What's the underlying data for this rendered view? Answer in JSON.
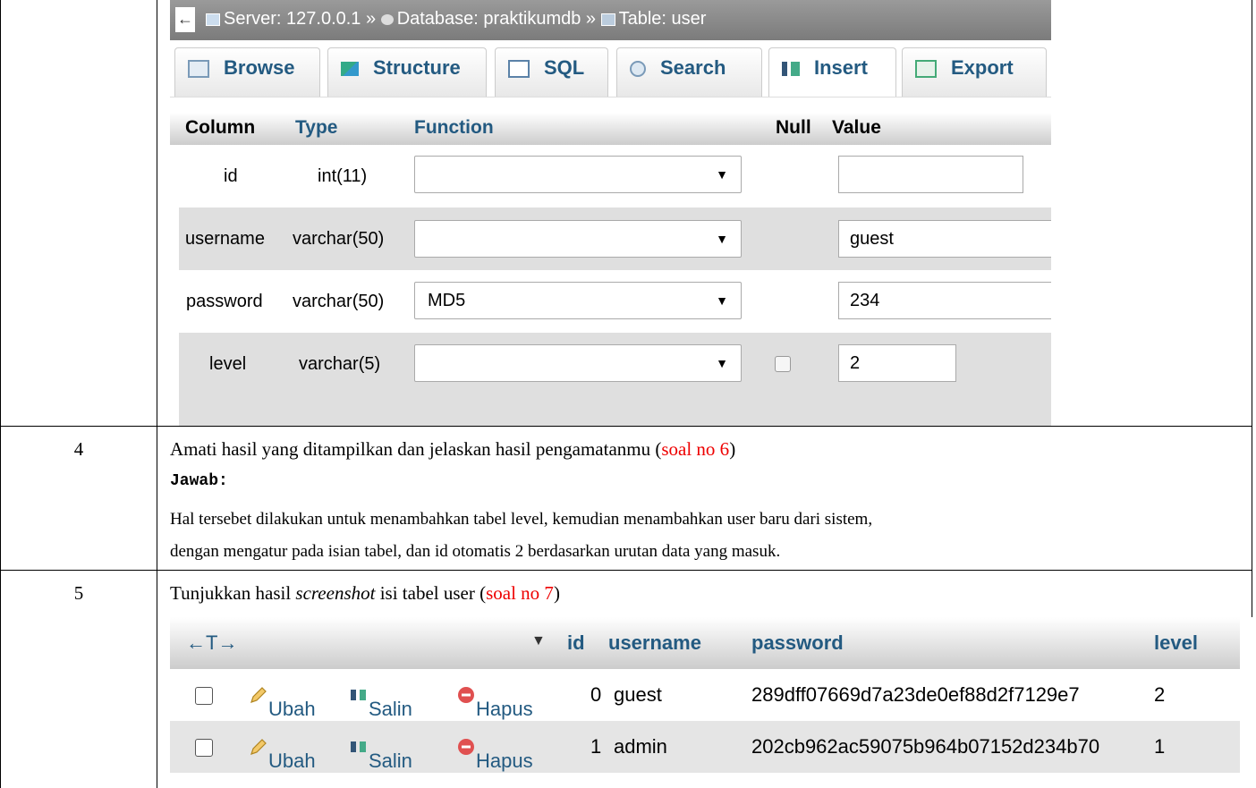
{
  "pma_insert": {
    "breadcrumb": {
      "back": "←",
      "server": "Server: 127.0.0.1",
      "sep": "»",
      "database": "Database: praktikumdb",
      "table": "Table: user"
    },
    "tabs": [
      {
        "label": "Browse",
        "icon": "browse-icon"
      },
      {
        "label": "Structure",
        "icon": "structure-icon"
      },
      {
        "label": "SQL",
        "icon": "sql-icon"
      },
      {
        "label": "Search",
        "icon": "search-icon"
      },
      {
        "label": "Insert",
        "icon": "insert-icon"
      },
      {
        "label": "Export",
        "icon": "export-icon"
      }
    ],
    "headers": {
      "column": "Column",
      "type": "Type",
      "function": "Function",
      "null": "Null",
      "value": "Value"
    },
    "rows": [
      {
        "column": "id",
        "type": "int(11)",
        "function": "",
        "value": ""
      },
      {
        "column": "username",
        "type": "varchar(50)",
        "function": "",
        "value": "guest"
      },
      {
        "column": "password",
        "type": "varchar(50)",
        "function": "MD5",
        "value": "234"
      },
      {
        "column": "level",
        "type": "varchar(5)",
        "function": "",
        "value": "2"
      }
    ],
    "arrow": "▼"
  },
  "doc": {
    "row4": {
      "number": "4",
      "instruction_a": "Amati hasil yang ditampilkan dan jelaskan hasil pengamatanmu (",
      "instruction_ref": "soal no 6",
      "instruction_b": ")",
      "jawab": "Jawab:",
      "answer_line1": "Hal tersebet dilakukan untuk menambahkan tabel level, kemudian menambahkan user baru dari sistem,",
      "answer_line2": "dengan mengatur pada isian tabel, dan id otomatis 2 berdasarkan urutan data yang masuk."
    },
    "row5": {
      "number": "5",
      "instruction_a": "Tunjukkan hasil ",
      "instruction_em": "screenshot",
      "instruction_b": " isi tabel user (",
      "instruction_ref": "soal no 7",
      "instruction_c": ")"
    }
  },
  "pma_browse": {
    "nav": "←T→",
    "sort_arrow": "▼",
    "headers": {
      "id": "id",
      "username": "username",
      "password": "password",
      "level": "level"
    },
    "actions": {
      "edit": "Ubah",
      "copy": "Salin",
      "delete": "Hapus"
    },
    "rows": [
      {
        "id": "0",
        "username": "guest",
        "password": "289dff07669d7a23de0ef88d2f7129e7",
        "level": "2"
      },
      {
        "id": "1",
        "username": "admin",
        "password": "202cb962ac59075b964b07152d234b70",
        "level": "1"
      }
    ]
  }
}
